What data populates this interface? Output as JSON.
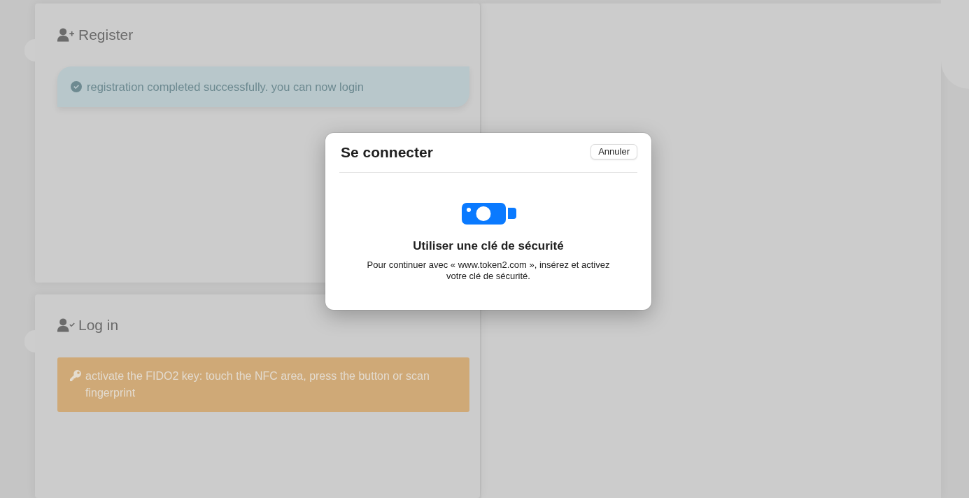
{
  "panels": [
    {
      "title": "Register",
      "alert": {
        "kind": "success",
        "text": "registration completed successfully. you can now login"
      }
    },
    {
      "title": "Log in",
      "alert": {
        "kind": "warning",
        "text": "activate the FIDO2 key: touch the NFC area, press the button or scan fingerprint"
      }
    }
  ],
  "dialog": {
    "title": "Se connecter",
    "cancel_button": "Annuler",
    "heading": "Utiliser une clé de sécurité",
    "message": "Pour continuer avec « www.token2.com », insérez et activez votre clé de sécurité."
  }
}
